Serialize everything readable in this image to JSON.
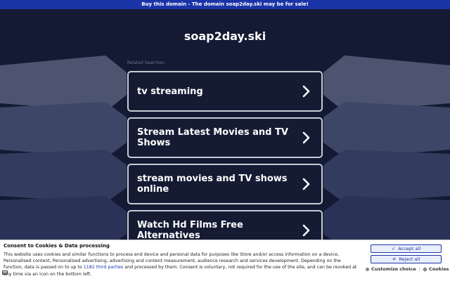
{
  "banner": {
    "text": "Buy this domain - The domain soap2day.ski may be for sale!"
  },
  "header": {
    "domain": "soap2day.ski"
  },
  "related": {
    "label": "Related Searches:"
  },
  "tiles": [
    {
      "label": "tv streaming"
    },
    {
      "label": "Stream Latest Movies and TV Shows"
    },
    {
      "label": "stream movies and TV shows online"
    },
    {
      "label": "Watch Hd Films Free Alternatives"
    }
  ],
  "consent": {
    "title": "Consent to Cookies & Data processing",
    "text_before_link": "This website uses cookies and similar functions to process end device and personal data for purposes like Store and/or access information on a device, Personalised content, Personalised advertising, advertising and content measurement, audience research and services development. Depending on the function, data is passed on to up to ",
    "link": "1182 third parties",
    "text_after_link": " and processed by them. Consent is voluntary, not required for the use of the site, and can be revoked at any time via an icon on the bottom left.",
    "accept_label": "Accept all",
    "reject_label": "Reject all",
    "customize_label": "Customize choice",
    "cookies_label": "Cookies"
  },
  "colors": {
    "banner": "#1a34a8",
    "background": "#141a33",
    "tile_border": "#c9cbd4",
    "button_text": "#1a34a8"
  },
  "icons": [
    "chevron-right-icon",
    "check-icon",
    "x-icon",
    "settings-dot-icon",
    "cookie-diamond-icon",
    "cookie-icon"
  ]
}
